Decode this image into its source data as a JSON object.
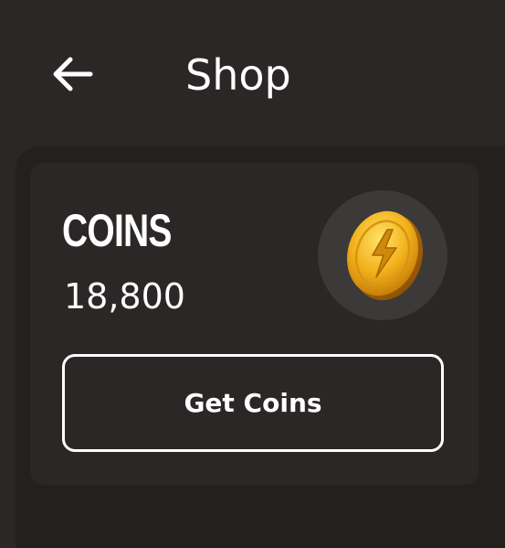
{
  "header": {
    "back_icon": "arrow-left-icon",
    "title": "Shop"
  },
  "coins_card": {
    "label": "COINS",
    "balance": "18,800",
    "coin_icon": "gold-coin-lightning-icon",
    "button_label": "Get Coins"
  },
  "colors": {
    "background": "#2a2726",
    "sheet": "#232020",
    "card": "#2a2726",
    "coin_badge": "#3c3939",
    "coin_gold": "#f2b21c",
    "text": "#ffffff"
  }
}
